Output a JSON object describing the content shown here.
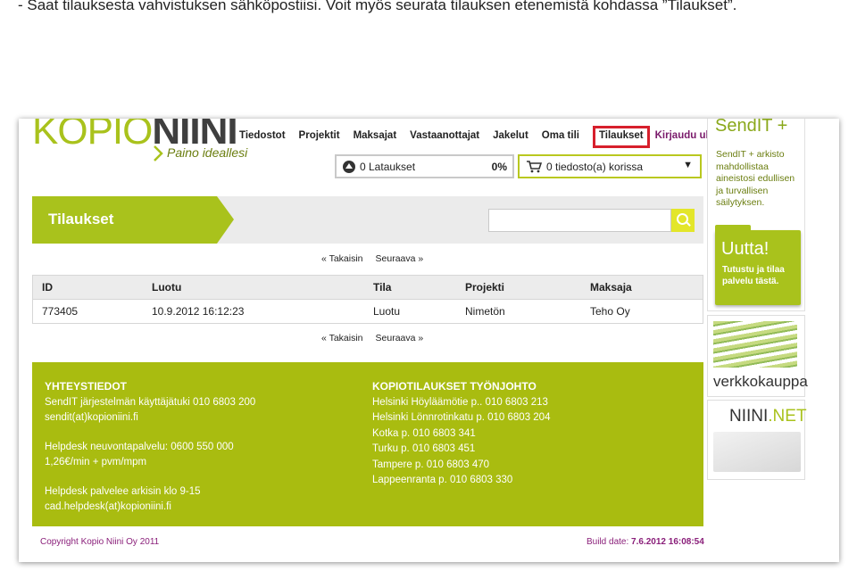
{
  "caption": "- Saat tilauksesta vahvistuksen sähköpostiisi. Voit myös seurata tilauksen etenemistä kohdassa ”Tilaukset”.",
  "logo": {
    "part1": "KOPIO",
    "part2": "NIINI",
    "tagline": "Paino ideallesi"
  },
  "nav": {
    "items": [
      "Tiedostot",
      "Projektit",
      "Maksajat",
      "Vastaanottajat",
      "Jakelut",
      "Oma tili"
    ],
    "active": "Tilaukset",
    "logout": "Kirjaudu ulos"
  },
  "downloads": {
    "label": "0 Lataukset",
    "percent": "0%"
  },
  "cart": {
    "label": "0 tiedosto(a) korissa",
    "arrow": "▼"
  },
  "page": {
    "title": "Tilaukset",
    "search_placeholder": ""
  },
  "pager": {
    "prev": "« Takaisin",
    "next": "Seuraava »"
  },
  "table": {
    "headers": [
      "ID",
      "Luotu",
      "Tila",
      "Projekti",
      "Maksaja"
    ],
    "rows": [
      [
        "773405",
        "10.9.2012 16:12:23",
        "Luotu",
        "Nimetön",
        "Teho Oy"
      ]
    ]
  },
  "footer": {
    "col1_title": "YHTEYSTIEDOT",
    "col1_lines_a": [
      "SendIT järjestelmän käyttäjätuki 010 6803 200",
      "sendit(at)kopioniini.fi"
    ],
    "col1_lines_b": [
      "Helpdesk neuvontapalvelu: 0600 550 000",
      "1,26€/min + pvm/mpm"
    ],
    "col1_lines_c": [
      "Helpdesk palvelee arkisin klo 9-15",
      "cad.helpdesk(at)kopioniini.fi"
    ],
    "col2_title": "KOPIOTILAUKSET TYÖNJOHTO",
    "col2_lines": [
      "Helsinki Höyläämötie p.. 010 6803 213",
      "Helsinki Lönnrotinkatu p. 010 6803 204",
      "Kotka p. 010 6803 341",
      "Turku p. 010 6803 451",
      "Tampere p. 010 6803 470",
      "Lappeenranta p. 010 6803 330"
    ]
  },
  "bottom": {
    "copyright": "Copyright Kopio Niini Oy 2011",
    "build_label": "Build date:",
    "build_value": "7.6.2012 16:08:54"
  },
  "ads": {
    "sendit_brand": "SendIT +",
    "sendit_desc": "SendIT + arkisto mahdollistaa aineistosi edullisen ja turvallisen säilytyksen.",
    "folder_title": "Uutta!",
    "folder_text": "Tutustu ja tilaa palvelu tästä.",
    "shop": "verkkokauppa",
    "niini_a": "NIINI",
    "niini_b": ".NET"
  },
  "colors": {
    "accent": "#a9c21c",
    "highlight": "#d71f2c",
    "footer_bg": "#a9bc10",
    "link": "#7a1a6b"
  },
  "icons": {
    "downloads": "upload-arrow-icon",
    "cart": "cart-icon",
    "search": "search-icon",
    "cart_dropdown": "chevron-down-icon"
  }
}
